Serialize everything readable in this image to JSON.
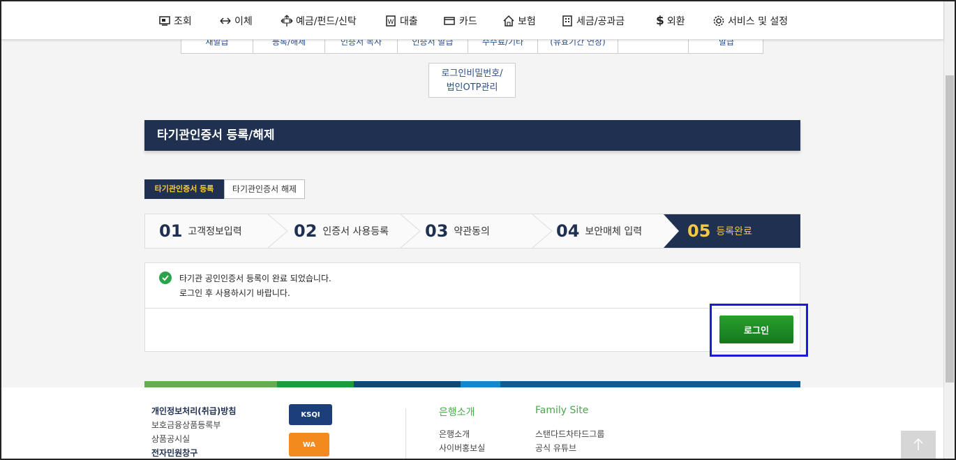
{
  "nav": {
    "items": [
      {
        "label": "조회",
        "icon": "monitor-icon"
      },
      {
        "label": "이체",
        "icon": "transfer-arrows-icon"
      },
      {
        "label": "예금/펀드/신탁",
        "icon": "cross-arrows-icon"
      },
      {
        "label": "대출",
        "icon": "won-document-icon"
      },
      {
        "label": "카드",
        "icon": "card-icon"
      },
      {
        "label": "보험",
        "icon": "house-icon"
      },
      {
        "label": "세금/공과금",
        "icon": "building-icon"
      },
      {
        "label": "외환",
        "icon": "dollar-icon"
      },
      {
        "label": "서비스 및 설정",
        "icon": "gear-icon"
      }
    ]
  },
  "subtabs": [
    "재발급",
    "등록/해제",
    "인증서 복사",
    "인증서 발급",
    "수수료/기타",
    "(유효기간 연장)",
    "",
    "발급"
  ],
  "otp_tab": {
    "line1": "로그인비밀번호/",
    "line2": "법인OTP관리"
  },
  "page_title": "타기관인증서 등록/해제",
  "tabs": {
    "active": "타기관인증서 등록",
    "inactive": "타기관인증서 해제"
  },
  "steps": [
    {
      "num": "01",
      "label": "고객정보입력"
    },
    {
      "num": "02",
      "label": "인증서 사용등록"
    },
    {
      "num": "03",
      "label": "약관동의"
    },
    {
      "num": "04",
      "label": "보안매체 입력"
    },
    {
      "num": "05",
      "label": "등록완료"
    }
  ],
  "message": {
    "line1": "타기관 공인인증서 등록이 완료 되었습니다.",
    "line2": "로그인 후 사용하시기 바랍니다."
  },
  "login_button": "로그인",
  "colors": {
    "navy": "#1f3050",
    "accent": "#f5c844",
    "green": "#1f8e26",
    "highlight": "#1a1adb"
  },
  "footer": {
    "left": [
      "개인정보처리(취급)방침",
      "보호금융상품등록부",
      "상품공시실",
      "전자민원창구"
    ],
    "badges": [
      "KSQI",
      "WA"
    ],
    "col1_title": "은행소개",
    "col1": [
      "은행소개",
      "사이버홍보실"
    ],
    "col2_title": "Family Site",
    "col2": [
      "스탠다드차타드그룹",
      "공식 유튜브"
    ]
  }
}
